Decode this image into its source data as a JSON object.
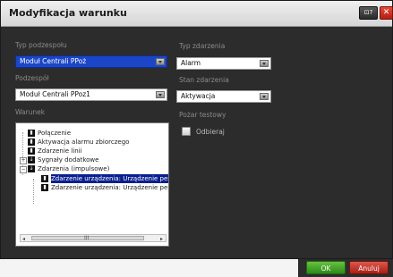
{
  "dialog": {
    "title": "Modyfikacja warunku",
    "help_label": "⊡?",
    "close_label": "✕"
  },
  "left": {
    "typ_label": "Typ podzespołu",
    "typ_value": "Moduł Centrali PPoż",
    "podzespol_label": "Podzespół",
    "podzespol_value": "Moduł Centrali PPoz1",
    "warunek_label": "Warunek"
  },
  "right": {
    "typ_zdarzenia_label": "Typ zdarzenia",
    "typ_zdarzenia_value": "Alarm",
    "stan_label": "Stan zdarzenia",
    "stan_value": "Aktywacja",
    "pozar_label": "Pożar testowy",
    "odbieraj_label": "Odbieraj"
  },
  "tree": {
    "items": [
      "Połączenie",
      "Aktywacja alarmu zbiorczego",
      "Zdarzenie linii",
      "Sygnały dodatkowe",
      "Zdarzenia (impulsowe)",
      "Zdarzenie urządzenia: Urządzenie per",
      "Zdarzenie urządzenia: Urządzenie per"
    ],
    "scroll_left": "◂",
    "scroll_right": "▸",
    "scroll_grip": "III"
  },
  "footer": {
    "ok_label": "OK",
    "cancel_label": "Anuluj"
  },
  "colors": {
    "accent": "#1b46c8",
    "ok": "#3f9e27",
    "cancel": "#c5322a",
    "dark_bg": "#2c2c2c"
  }
}
